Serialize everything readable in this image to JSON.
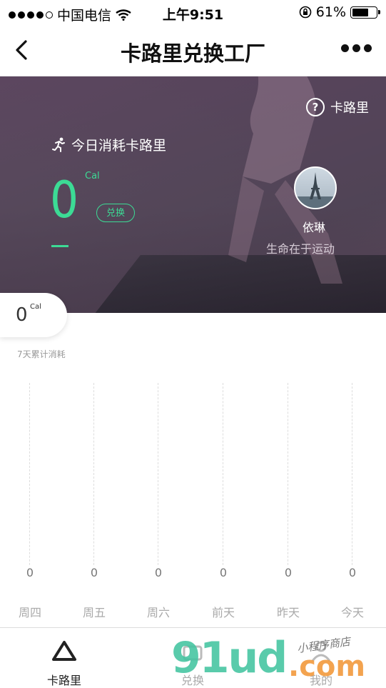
{
  "status_bar": {
    "carrier": "中国电信",
    "time": "上午9:51",
    "battery": "61%"
  },
  "nav": {
    "title": "卡路里兑换工厂",
    "back_icon": "chevron-left-icon",
    "more_icon": "more-dots-icon"
  },
  "hero": {
    "help_label": "卡路里",
    "today_label": "今日消耗卡路里",
    "today_value": "0",
    "unit": "Cal",
    "exchange_label": "兑换",
    "username": "依琳",
    "motto": "生命在于运动"
  },
  "week": {
    "value": "0",
    "unit": "Cal",
    "label": "7天累计消耗"
  },
  "chart_data": {
    "type": "bar",
    "categories": [
      "周四",
      "周五",
      "周六",
      "前天",
      "昨天",
      "今天"
    ],
    "values": [
      0,
      0,
      0,
      0,
      0,
      0
    ],
    "value_labels": [
      "0",
      "0",
      "0",
      "0",
      "0",
      "0"
    ]
  },
  "tabbar": {
    "items": [
      {
        "label": "卡路里",
        "icon": "triangle-icon"
      },
      {
        "label": "兑换",
        "icon": "gift-icon"
      },
      {
        "label": "我的",
        "icon": "user-icon"
      }
    ]
  },
  "watermark": {
    "main": "91ud",
    "suffix": ".com",
    "sub": "小程序商店"
  },
  "colors": {
    "accent": "#3cdb95",
    "hero_overlay": "#4e3852",
    "watermark_green": "#43c4a0",
    "watermark_orange": "#f29a3d"
  }
}
